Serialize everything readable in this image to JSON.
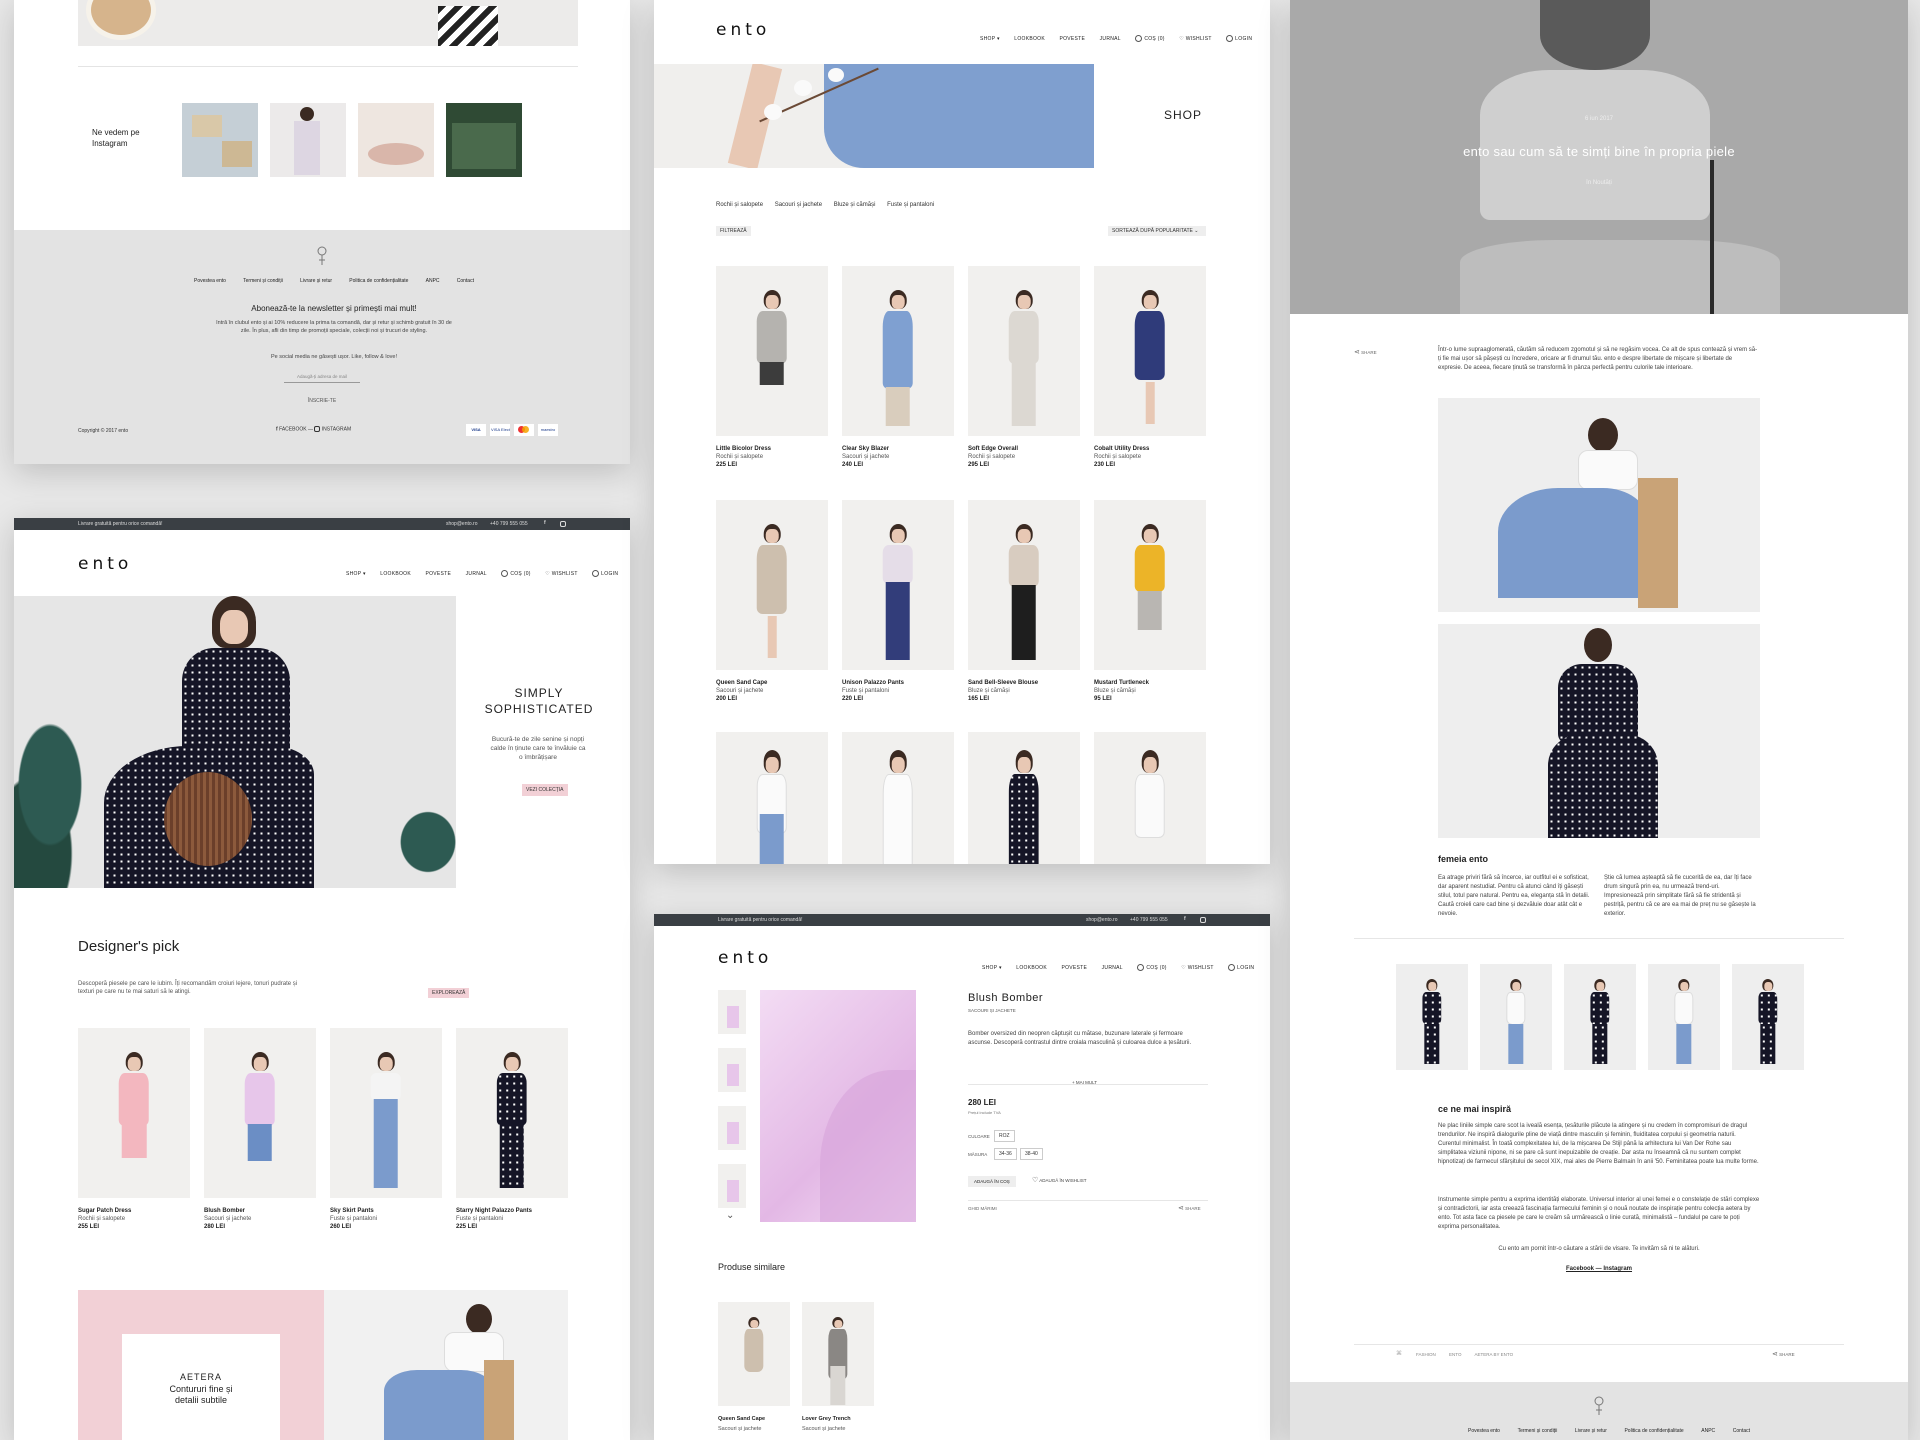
{
  "brand": {
    "logo": "ento",
    "accent_pink": "#f2d0d6",
    "topbar_color": "#3a3f44"
  },
  "nav": {
    "shop": "SHOP ▾",
    "lookbook": "LOOKBOOK",
    "poveste": "POVESTE",
    "jurnal": "JURNAL",
    "cos": "COȘ (0)",
    "wishlist": "WISHLIST",
    "login": "LOGIN"
  },
  "topbar": {
    "left": "Livrare gratuită pentru orice comandă!",
    "email": "shop@ento.ro",
    "phone": "+40 799 555 055"
  },
  "footer": {
    "instagram_label": "Ne vedem pe Instagram",
    "links": [
      "Povestea ento",
      "Termeni și condiții",
      "Livrare și retur",
      "Politica de confidențialitate",
      "ANPC",
      "Contact"
    ],
    "newsletter_title": "Abonează-te la newsletter și primești mai mult!",
    "newsletter_text_1": "Intră în clubul ento și ai 10% reducere la prima ta comandă, dar și retur și schimb gratuit în 30 de zile. În plus, afli din timp de promoții speciale, colecții noi și trucuri de styling.",
    "newsletter_text_2": "Pe social media ne găsești ușor. Like, follow & love!",
    "email_placeholder": "Adaugă-ți adresa de mail",
    "subscribe": "ÎNSCRIE-TE",
    "copyright": "Copyright © 2017 ento",
    "facebook": "FACEBOOK",
    "instagram": "INSTAGRAM",
    "payments": [
      "VISA",
      "VISA Electron",
      "MC",
      "maestro"
    ]
  },
  "home": {
    "hero_title": "SIMPLY SOPHISTICATED",
    "hero_text": "Bucură-te de zile senine și nopți calde în ținute care te învăluie ca o îmbrățișare",
    "hero_button": "VEZI COLECȚIA",
    "picks_title": "Designer's pick",
    "picks_text": "Descoperă piesele pe care le iubim. Îți recomandăm croiuri lejere, tonuri pudrate și texturi pe care nu te mai saturi să le atingi.",
    "picks_button": "EXPLOREAZĂ",
    "picks": [
      {
        "name": "Sugar Patch Dress",
        "cat": "Rochii și salopete",
        "price": "255 LEI"
      },
      {
        "name": "Blush Bomber",
        "cat": "Sacouri și jachete",
        "price": "280 LEI"
      },
      {
        "name": "Sky Skirt Pants",
        "cat": "Fuste și pantaloni",
        "price": "260 LEI"
      },
      {
        "name": "Starry Night Palazzo Pants",
        "cat": "Fuste și pantaloni",
        "price": "225 LEI"
      }
    ],
    "aetera_1": "AETERA",
    "aetera_2": "Contururi fine și detalii subtile"
  },
  "shop": {
    "title": "SHOP",
    "categories": [
      "Rochii și salopete",
      "Sacouri și jachete",
      "Bluze și cămăși",
      "Fuste și pantaloni"
    ],
    "filter": "FILTREAZĂ",
    "sort": "SORTEAZĂ DUPĂ POPULARITATE",
    "products": [
      {
        "name": "Little Bicolor Dress",
        "cat": "Rochii și salopete",
        "price": "225 LEI"
      },
      {
        "name": "Clear Sky Blazer",
        "cat": "Sacouri și jachete",
        "price": "240 LEI"
      },
      {
        "name": "Soft Edge Overall",
        "cat": "Rochii și salopete",
        "price": "295 LEI"
      },
      {
        "name": "Cobalt Utility Dress",
        "cat": "Rochii și salopete",
        "price": "230 LEI"
      },
      {
        "name": "Queen Sand Cape",
        "cat": "Sacouri și jachete",
        "price": "200 LEI"
      },
      {
        "name": "Unison Palazzo Pants",
        "cat": "Fuste și pantaloni",
        "price": "220 LEI"
      },
      {
        "name": "Sand Bell-Sleeve Blouse",
        "cat": "Bluze și cămăși",
        "price": "165 LEI"
      },
      {
        "name": "Mustard Turtleneck",
        "cat": "Bluze și cămăși",
        "price": "95 LEI"
      }
    ]
  },
  "product": {
    "name": "Blush Bomber",
    "category": "SACOURI ȘI JACHETE",
    "description": "Bomber oversized din neopren căptușit cu mătase, buzunare laterale și fermoare ascunse. Descoperă contrastul dintre croiala masculină și culoarea dulce a țesăturii.",
    "more": "+ MAI MULT",
    "price": "280 LEI",
    "price_note": "Prețul include TVA",
    "color_label": "CULOARE",
    "color": "ROZ",
    "size_label": "MĂSURA",
    "sizes": [
      "34-36",
      "38-40"
    ],
    "add_cart": "ADAUGĂ ÎN COȘ",
    "add_wish": "ADAUGĂ ÎN WISHLIST",
    "size_guide": "GHID MĂRIMI",
    "share": "SHARE",
    "similar_title": "Produse similare",
    "similar": [
      {
        "name": "Queen Sand Cape",
        "cat": "Sacouri și jachete"
      },
      {
        "name": "Lover Grey Trench",
        "cat": "Sacouri și jachete"
      }
    ]
  },
  "blog": {
    "date": "6 iun 2017",
    "title": "ento sau cum să te simți bine în propria piele",
    "category": "în Noutăți",
    "share": "SHARE",
    "intro": "Într-o lume supraaglomerată, căutăm să reducem zgomotul și să ne regăsim vocea. Ce alt de spus contează și vrem să-ți fie mai ușor să pășești cu încredere, oricare ar fi drumul tău. ento e despre libertate de mișcare și libertate de expresie. De aceea, fiecare ținută se transformă în pânza perfectă pentru culorile tale interioare.",
    "section1_title": "femeia ento",
    "section1_col1": "Ea atrage priviri fără să încerce, iar outfitul ei e sofisticat, dar aparent nestudiat. Pentru că atunci când îți găsești stilul, totul pare natural. Pentru ea, eleganța stă în detalii. Caută croieli care cad bine și dezvăluie doar atât cât e nevoie.",
    "section1_col2": "Știe că lumea așteaptă să fie cucerită de ea, dar îți face drum singură prin ea, nu urmează trend-uri. Impresionează prin simplitate fără să fie stridentă și pestriță, pentru că ce are ea mai de preț nu se găsește la exterior.",
    "section2_title": "ce ne mai inspiră",
    "section2_p1": "Ne plac liniile simple care scot la iveală esența, țesăturile plăcute la atingere și nu credem în compromisuri de dragul trendurilor. Ne inspiră dialogurile pline de viață dintre masculin și feminin, fluiditatea corpului și geometria naturii. Curentul minimalist. În toată complexitatea lui, de la mișcarea De Stijl până la arhitectura lui Van Der Rohe sau simplitatea viziunii nipone, ni se pare că sunt inepuizabile de creație. Dar asta nu înseamnă că nu suntem complet hipnotizați de farmecul sfârșitului de secol XIX, mai ales de Pierre Balmain în anii '50. Feminitatea poate lua multe forme.",
    "section2_p2": "Instrumente simple pentru a exprima identități elaborate. Universul interior al unei femei e o constelație de stări complexe și contradictorii, iar asta creează fascinația farmecului feminin și o nouă noutate de inspirație pentru colecția aetera by ento. Tot asta face ca piesele pe care le creăm să urmărească o linie curată, minimalistă – fundalul pe care te poți exprima personalitatea.",
    "section2_p3": "Cu ento am pornit într-o căutare a stării de visare. Te invităm să ni te alături.",
    "links": "Facebook — Instagram",
    "tags": [
      "FASHION",
      "ENTO",
      "AETERA BY ENTO"
    ]
  }
}
